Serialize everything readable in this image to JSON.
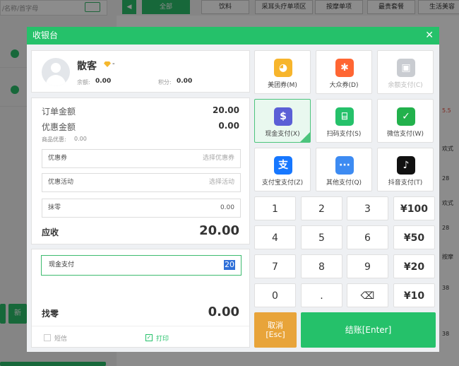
{
  "background": {
    "search_placeholder": "/名称/首字母",
    "categories": [
      "全部",
      "饮料",
      "采耳头疗单项区",
      "按摩单项",
      "最贵套餐",
      "生活美容"
    ],
    "side_snippets": [
      "5.5",
      "欢式",
      "28",
      "28",
      "欢式",
      "28",
      "按摩",
      "38",
      "38"
    ],
    "left_button_char": "新"
  },
  "dialog": {
    "title": "收银台",
    "close_glyph": "✕",
    "customer": {
      "name": "散客",
      "level_suffix": "-",
      "balance_label": "余额:",
      "balance_value": "0.00",
      "points_label": "积分:",
      "points_value": "0.00"
    },
    "order": {
      "order_amount_label": "订单金额",
      "order_amount_value": "20.00",
      "discount_amount_label": "优惠金额",
      "discount_amount_value": "0.00",
      "goods_discount_label": "商品优惠:",
      "goods_discount_value": "0.00",
      "coupon_label": "优惠券",
      "coupon_placeholder": "选择优惠券",
      "promo_label": "优惠活动",
      "promo_placeholder": "选择活动",
      "rounding_label": "抹零",
      "rounding_value": "0.00",
      "receivable_label": "应收",
      "receivable_value": "20.00"
    },
    "payment_entry": {
      "method_label": "现金支付",
      "amount": "20"
    },
    "change": {
      "label": "找零",
      "value": "0.00"
    },
    "options": {
      "sms_label": "短信",
      "sms_checked": false,
      "print_label": "打印",
      "print_checked": true
    },
    "pay_methods": [
      {
        "label": "美团券(M)",
        "icon": "meituan-icon",
        "color": "#f7b52c",
        "glyph": "◕"
      },
      {
        "label": "大众券(D)",
        "icon": "dianping-icon",
        "color": "#ff6633",
        "glyph": "✱"
      },
      {
        "label": "余额支付(C)",
        "icon": "wallet-icon",
        "color": "#c9ccd1",
        "glyph": "▣"
      },
      {
        "label": "现金支付(X)",
        "icon": "cash-bag-icon",
        "color": "#5b5fd6",
        "glyph": "$"
      },
      {
        "label": "扫码支付(S)",
        "icon": "scan-icon",
        "color": "#25c16a",
        "glyph": "⌸"
      },
      {
        "label": "微信支付(W)",
        "icon": "wechat-pay-icon",
        "color": "#22b14c",
        "glyph": "✓"
      },
      {
        "label": "支付宝支付(Z)",
        "icon": "alipay-icon",
        "color": "#1677ff",
        "glyph": "支"
      },
      {
        "label": "其他支付(Q)",
        "icon": "more-icon",
        "color": "#3d8bf2",
        "glyph": "···"
      },
      {
        "label": "抖音支付(T)",
        "icon": "douyin-icon",
        "color": "#111111",
        "glyph": "♪"
      }
    ],
    "selected_method": "现金支付(X)",
    "keypad": [
      "1",
      "2",
      "3",
      "¥100",
      "4",
      "5",
      "6",
      "¥50",
      "7",
      "8",
      "9",
      "¥20",
      "0",
      ".",
      "⌫",
      "¥10"
    ],
    "cancel_label_line1": "取消",
    "cancel_label_line2": "[Esc]",
    "checkout_label": "结账[Enter]",
    "colors": {
      "primary": "#25c16a",
      "cancel": "#e8a43a",
      "header": "#25c16a"
    }
  }
}
